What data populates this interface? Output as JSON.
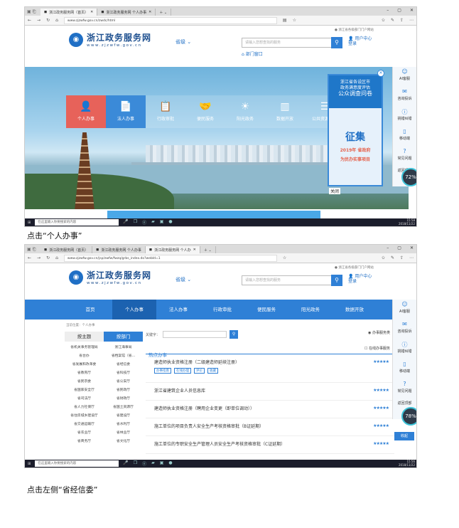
{
  "screenshot1": {
    "tabs": [
      {
        "label": "浙江政务服务网（首页）"
      },
      {
        "label": "浙江政务服务网 个人办事"
      }
    ],
    "url": "www.zjzwfw.gov.cn/zwdc/html",
    "site": {
      "logo_title": "浙江政务服务网",
      "logo_sub": "www.zjzwfw.gov.cn",
      "province": "省级",
      "fav": "浙江省各级部门门户网站",
      "search_placeholder": "请输入您想查找的服务",
      "user_center": "用户中心",
      "user_login": "登录",
      "dept_window": "部门窗口"
    },
    "categories": [
      {
        "label": "个人办事",
        "icon": "person-icon"
      },
      {
        "label": "法人办事",
        "icon": "document-icon"
      },
      {
        "label": "行政审批",
        "icon": "clipboard-icon"
      },
      {
        "label": "便民服务",
        "icon": "handshake-icon"
      },
      {
        "label": "阳光政务",
        "icon": "sun-icon"
      },
      {
        "label": "数据开放",
        "icon": "bar-chart-icon"
      },
      {
        "label": "公共资源交易",
        "icon": "server-icon"
      }
    ],
    "survey": {
      "line1": "浙江省各设区市",
      "line2": "政务满意度评估",
      "line3": "公众调查问卷",
      "big": "征集",
      "year": "2019年 省政府",
      "sub": "为民办实事项目",
      "close_label": "关闭"
    },
    "sidebar": [
      {
        "label": "AI客服",
        "icon": "robot-icon"
      },
      {
        "label": "咨询投诉",
        "icon": "chat-icon"
      },
      {
        "label": "挑错纠错",
        "icon": "info-icon"
      },
      {
        "label": "移动端",
        "icon": "phone-icon"
      },
      {
        "label": "常见问题",
        "icon": "question-icon"
      },
      {
        "label": "返回顶部",
        "icon": "up-icon"
      }
    ],
    "gauge": "72%",
    "taskbar": {
      "search": "在这里输入你要搜索的内容",
      "time": "15:58",
      "date": "2018/11/22"
    }
  },
  "caption1": "点击“个人办事”",
  "screenshot2": {
    "tabs": [
      {
        "label": "浙江政务服务网（首页）"
      },
      {
        "label": "浙江政务服务网 个人办事"
      },
      {
        "label": "浙江政务服务网 个人办"
      }
    ],
    "url": "www.zjzwfw.gov.cn/jsp/zwfw/fwzq/grbs_index.do?webId=1",
    "nav": [
      "首页",
      "个人办事",
      "法人办事",
      "行政审批",
      "便民服务",
      "阳光政务",
      "数据开放"
    ],
    "breadcrumb": "当前位置：个人办事",
    "left_tabs": [
      "按主题",
      "按部门"
    ],
    "departments": [
      "省机关事务管理局",
      "浙江海事局",
      "省台办",
      "省档案馆（省...",
      "省发展和改革委",
      "省经信委",
      "省教育厅",
      "省科技厅",
      "省民宗委",
      "省公安厅",
      "省国家安全厅",
      "省民政厅",
      "省司法厅",
      "省财政厅",
      "省人力社保厅",
      "省国土资源厅",
      "省住房城乡建设厅",
      "省建设厅",
      "省交通运输厅",
      "省水利厅",
      "省农业厅",
      "省林业厅",
      "省商务厅",
      "省文化厅"
    ],
    "keyword_label": "关键字：",
    "radio_label": "办事服务类",
    "hot_label": "热点办事",
    "online_label": "在线办事服务",
    "items": [
      {
        "title": "建造师执业资格注册（二级建造师延续注册）",
        "tags": [
          "办事指南",
          "在线办理",
          "评价",
          "收藏"
        ]
      },
      {
        "title": "浙江省建筑企业人员信息库"
      },
      {
        "title": "建造师执业资格注册（聘用企业变更（即单位调动））"
      },
      {
        "title": "施工单位的项目负责人安全生产考核资格审批（B证延期）"
      },
      {
        "title": "施工单位的专职安全生产管理人员安全生产考核资格审批（C证延期）"
      }
    ],
    "stars": "★★★★★",
    "collapse": "收起",
    "gauge": "78%",
    "taskbar": {
      "search": "在这里输入你要搜索的内容",
      "time": "15:56",
      "date": "2018/11/22"
    }
  },
  "caption2": "点击左侧“省经信委”"
}
